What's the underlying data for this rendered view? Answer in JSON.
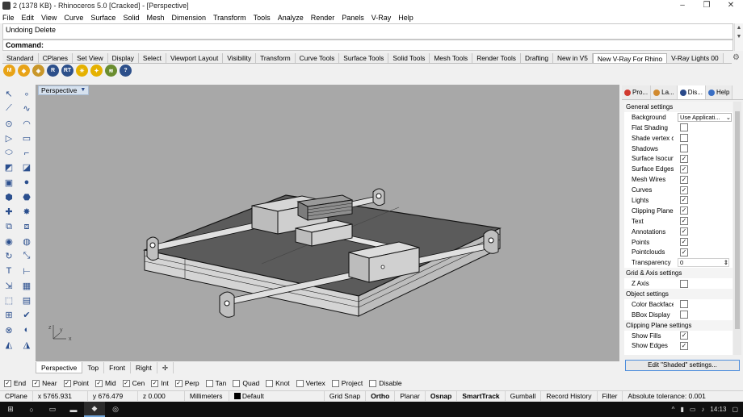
{
  "window": {
    "title": "2 (1378 KB) - Rhinoceros 5.0 [Cracked] - [Perspective]",
    "minimize": "–",
    "restore": "❐",
    "close": "✕"
  },
  "menu": [
    "File",
    "Edit",
    "View",
    "Curve",
    "Surface",
    "Solid",
    "Mesh",
    "Dimension",
    "Transform",
    "Tools",
    "Analyze",
    "Render",
    "Panels",
    "V-Ray",
    "Help"
  ],
  "command": {
    "history": "Undoing Delete",
    "prompt": "Command:"
  },
  "toolbar_tabs": [
    "Standard",
    "CPlanes",
    "Set View",
    "Display",
    "Select",
    "Viewport Layout",
    "Visibility",
    "Transform",
    "Curve Tools",
    "Surface Tools",
    "Solid Tools",
    "Mesh Tools",
    "Render Tools",
    "Drafting",
    "New in V5",
    "New V-Ray For Rhino",
    "V-Ray Lights 00"
  ],
  "active_toolbar_tab": "New V-Ray For Rhino",
  "vray_icons": [
    {
      "name": "vray-m-icon",
      "glyph": "M",
      "color": "#e8a317"
    },
    {
      "name": "vray-material-icon",
      "glyph": "◆",
      "color": "#e8a317"
    },
    {
      "name": "vray-layers-icon",
      "glyph": "◈",
      "color": "#c9972a"
    },
    {
      "name": "vray-render-icon",
      "glyph": "R",
      "color": "#2c4f8a"
    },
    {
      "name": "vray-rt-icon",
      "glyph": "RT",
      "color": "#2c4f8a"
    },
    {
      "name": "vray-sun-icon",
      "glyph": "☀",
      "color": "#e5b100"
    },
    {
      "name": "vray-light-icon",
      "glyph": "✦",
      "color": "#e5b100"
    },
    {
      "name": "vray-dome-icon",
      "glyph": "≋",
      "color": "#6a8d2f"
    },
    {
      "name": "vray-help-icon",
      "glyph": "?",
      "color": "#2c4f8a"
    }
  ],
  "left_tools": [
    {
      "name": "select-arrow-icon",
      "glyph": "↖"
    },
    {
      "name": "point-icon",
      "glyph": "∘"
    },
    {
      "name": "polyline-icon",
      "glyph": "⟋"
    },
    {
      "name": "curve-icon",
      "glyph": "∿"
    },
    {
      "name": "circle-icon",
      "glyph": "⊙"
    },
    {
      "name": "arc-icon",
      "glyph": "◠"
    },
    {
      "name": "polygon-icon",
      "glyph": "▷"
    },
    {
      "name": "rectangle-icon",
      "glyph": "▭"
    },
    {
      "name": "ellipse-icon",
      "glyph": "⬭"
    },
    {
      "name": "fillet-icon",
      "glyph": "⌐"
    },
    {
      "name": "surface-icon",
      "glyph": "◩"
    },
    {
      "name": "surface-edit-icon",
      "glyph": "◪"
    },
    {
      "name": "box-solid-icon",
      "glyph": "▣"
    },
    {
      "name": "sphere-icon",
      "glyph": "●"
    },
    {
      "name": "mesh-icon",
      "glyph": "⬢"
    },
    {
      "name": "extrude-icon",
      "glyph": "⬣"
    },
    {
      "name": "boolean-icon",
      "glyph": "✚"
    },
    {
      "name": "explode-icon",
      "glyph": "✸"
    },
    {
      "name": "join-icon",
      "glyph": "⧉"
    },
    {
      "name": "split-icon",
      "glyph": "⧈"
    },
    {
      "name": "fillet-solid-icon",
      "glyph": "◉"
    },
    {
      "name": "blend-icon",
      "glyph": "◍"
    },
    {
      "name": "rotate-icon",
      "glyph": "↻"
    },
    {
      "name": "scale-icon",
      "glyph": "⤡"
    },
    {
      "name": "text-icon",
      "glyph": "T"
    },
    {
      "name": "dimension-icon",
      "glyph": "⊢"
    },
    {
      "name": "transform-icon",
      "glyph": "⇲"
    },
    {
      "name": "array-icon",
      "glyph": "▦"
    },
    {
      "name": "cube-view-icon",
      "glyph": "⬚"
    },
    {
      "name": "grid-icon",
      "glyph": "▤"
    },
    {
      "name": "array-grid-icon",
      "glyph": "⊞"
    },
    {
      "name": "check-icon",
      "glyph": "✔"
    },
    {
      "name": "analysis-icon",
      "glyph": "⊗"
    },
    {
      "name": "render-icon",
      "glyph": "◐"
    },
    {
      "name": "paint-icon",
      "glyph": "◭"
    },
    {
      "name": "light-icon",
      "glyph": "◮"
    }
  ],
  "viewport": {
    "label": "Perspective",
    "axis_z": "z",
    "axis_y": "y",
    "axis_x": "x"
  },
  "viewport_tabs": [
    "Perspective",
    "Top",
    "Front",
    "Right",
    "✢"
  ],
  "panel": {
    "tabs": [
      {
        "label": "Pro...",
        "color": "#d13a2f"
      },
      {
        "label": "La...",
        "color": "#d18a2f"
      },
      {
        "label": "Dis...",
        "color": "#2a4a8a"
      },
      {
        "label": "Help",
        "color": "#3a6fc4"
      }
    ],
    "rows": [
      {
        "type": "section",
        "label": "General settings"
      },
      {
        "type": "select",
        "label": "Background",
        "value": "Use Applicati..."
      },
      {
        "type": "check",
        "label": "Flat Shading",
        "checked": false
      },
      {
        "type": "check",
        "label": "Shade vertex c...",
        "checked": false
      },
      {
        "type": "check",
        "label": "Shadows",
        "checked": false
      },
      {
        "type": "check",
        "label": "Surface Isocurv...",
        "checked": true
      },
      {
        "type": "check",
        "label": "Surface Edges",
        "checked": true
      },
      {
        "type": "check",
        "label": "Mesh Wires",
        "checked": true
      },
      {
        "type": "check",
        "label": "Curves",
        "checked": true
      },
      {
        "type": "check",
        "label": "Lights",
        "checked": true
      },
      {
        "type": "check",
        "label": "Clipping Planes",
        "checked": true
      },
      {
        "type": "check",
        "label": "Text",
        "checked": true
      },
      {
        "type": "check",
        "label": "Annotations",
        "checked": true
      },
      {
        "type": "check",
        "label": "Points",
        "checked": true
      },
      {
        "type": "check",
        "label": "Pointclouds",
        "checked": true
      },
      {
        "type": "number",
        "label": "Transparency",
        "value": "0"
      },
      {
        "type": "section",
        "label": "Grid & Axis settings"
      },
      {
        "type": "check",
        "label": "Z Axis",
        "checked": false
      },
      {
        "type": "section",
        "label": "Object settings"
      },
      {
        "type": "check",
        "label": "Color Backfaces",
        "checked": false
      },
      {
        "type": "check",
        "label": "BBox Display",
        "checked": false
      },
      {
        "type": "section",
        "label": "Clipping Plane settings"
      },
      {
        "type": "check",
        "label": "Show Fills",
        "checked": true
      },
      {
        "type": "check",
        "label": "Show Edges",
        "checked": true
      }
    ],
    "edit_button": "Edit \"Shaded\" settings..."
  },
  "osnap": [
    {
      "label": "End",
      "checked": true
    },
    {
      "label": "Near",
      "checked": true
    },
    {
      "label": "Point",
      "checked": true
    },
    {
      "label": "Mid",
      "checked": true
    },
    {
      "label": "Cen",
      "checked": true
    },
    {
      "label": "Int",
      "checked": true
    },
    {
      "label": "Perp",
      "checked": true
    },
    {
      "label": "Tan",
      "checked": false
    },
    {
      "label": "Quad",
      "checked": false
    },
    {
      "label": "Knot",
      "checked": false
    },
    {
      "label": "Vertex",
      "checked": false
    },
    {
      "label": "Project",
      "checked": false
    },
    {
      "label": "Disable",
      "checked": false
    }
  ],
  "status": {
    "cplane": "CPlane",
    "x": "x 5765.931",
    "y": "y 676.479",
    "z": "z 0.000",
    "units": "Millimeters",
    "layer": "Default",
    "grid_snap": "Grid Snap",
    "ortho": "Ortho",
    "planar": "Planar",
    "osnap": "Osnap",
    "smarttrack": "SmartTrack",
    "gumball": "Gumball",
    "record_history": "Record History",
    "filter": "Filter",
    "tolerance": "Absolute tolerance: 0.001"
  },
  "taskbar": {
    "time": "14:13"
  }
}
